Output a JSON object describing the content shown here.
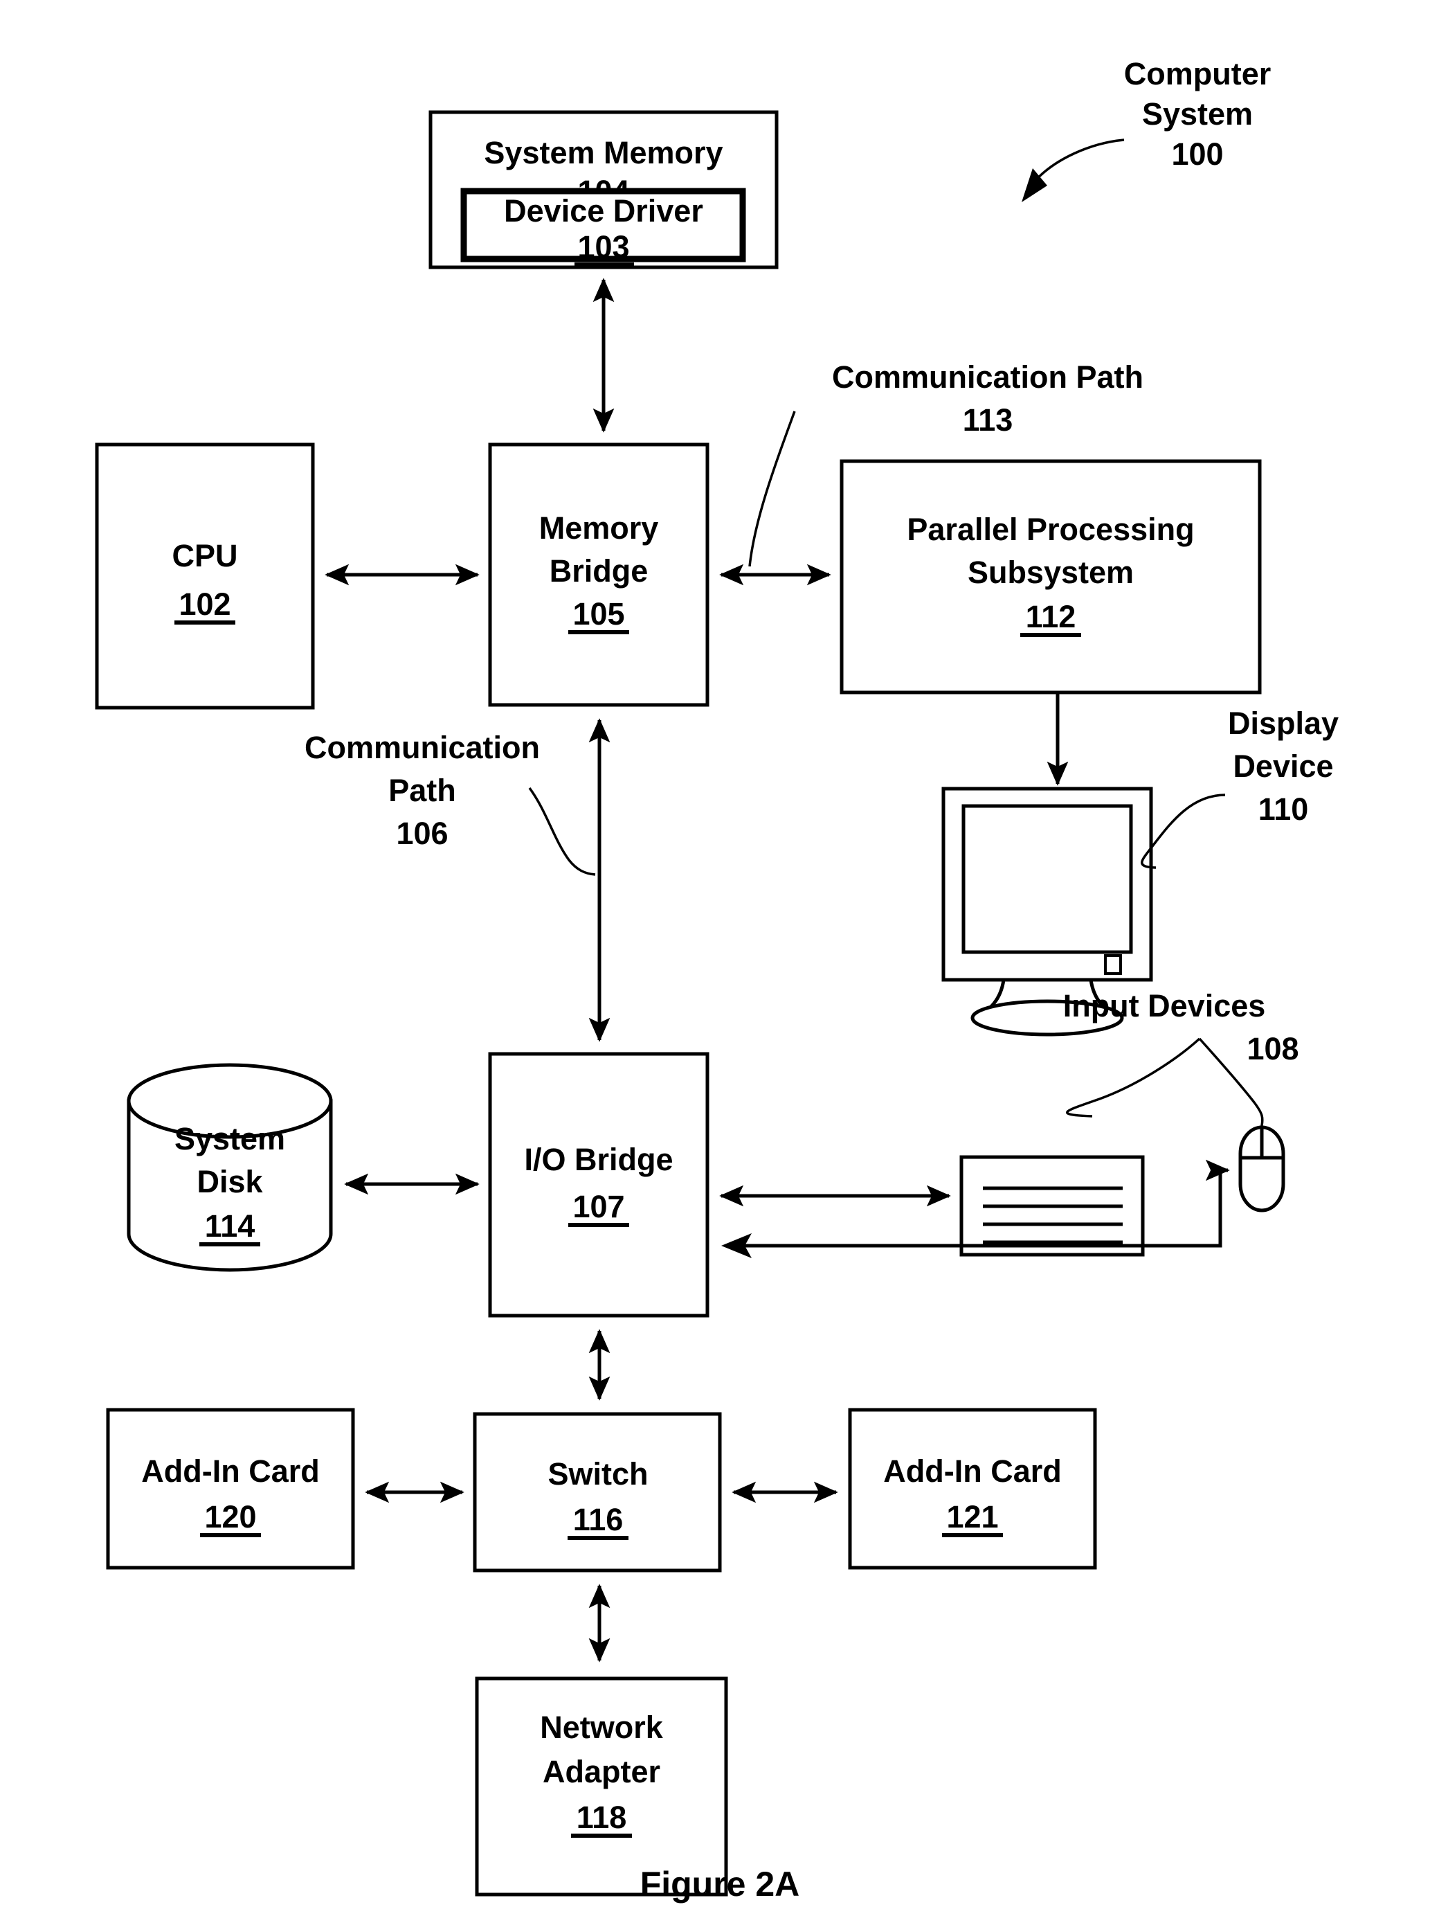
{
  "figure": {
    "caption": "Figure 2A",
    "annotation": {
      "computer_system_line1": "Computer",
      "computer_system_line2": "System",
      "computer_system_ref": "100"
    }
  },
  "blocks": {
    "system_memory": {
      "label": "System Memory",
      "ref": "104"
    },
    "device_driver": {
      "label": "Device Driver",
      "ref": "103"
    },
    "cpu": {
      "label": "CPU",
      "ref": "102"
    },
    "memory_bridge": {
      "label_line1": "Memory",
      "label_line2": "Bridge",
      "ref": "105"
    },
    "parallel_processing_subsystem": {
      "label_line1": "Parallel Processing",
      "label_line2": "Subsystem",
      "ref": "112"
    },
    "io_bridge": {
      "label": "I/O Bridge",
      "ref": "107"
    },
    "system_disk": {
      "label_line1": "System",
      "label_line2": "Disk",
      "ref": "114"
    },
    "switch": {
      "label": "Switch",
      "ref": "116"
    },
    "add_in_card_left": {
      "label": "Add-In Card",
      "ref": "120"
    },
    "add_in_card_right": {
      "label": "Add-In Card",
      "ref": "121"
    },
    "network_adapter": {
      "label_line1": "Network",
      "label_line2": "Adapter",
      "ref": "118"
    }
  },
  "callouts": {
    "communication_path_113": {
      "line1": "Communication Path",
      "ref": "113"
    },
    "communication_path_106": {
      "line1": "Communication",
      "line2": "Path",
      "ref": "106"
    },
    "display_device": {
      "line1": "Display",
      "line2": "Device",
      "ref": "110"
    },
    "input_devices": {
      "line1": "Input Devices",
      "ref": "108"
    }
  },
  "icons": {
    "display_device_icon": "monitor-icon",
    "keyboard_icon": "keyboard-icon",
    "mouse_icon": "mouse-icon",
    "system_disk_icon": "cylinder-database-icon"
  },
  "colors": {
    "stroke": "#000000",
    "fill": "#ffffff"
  }
}
